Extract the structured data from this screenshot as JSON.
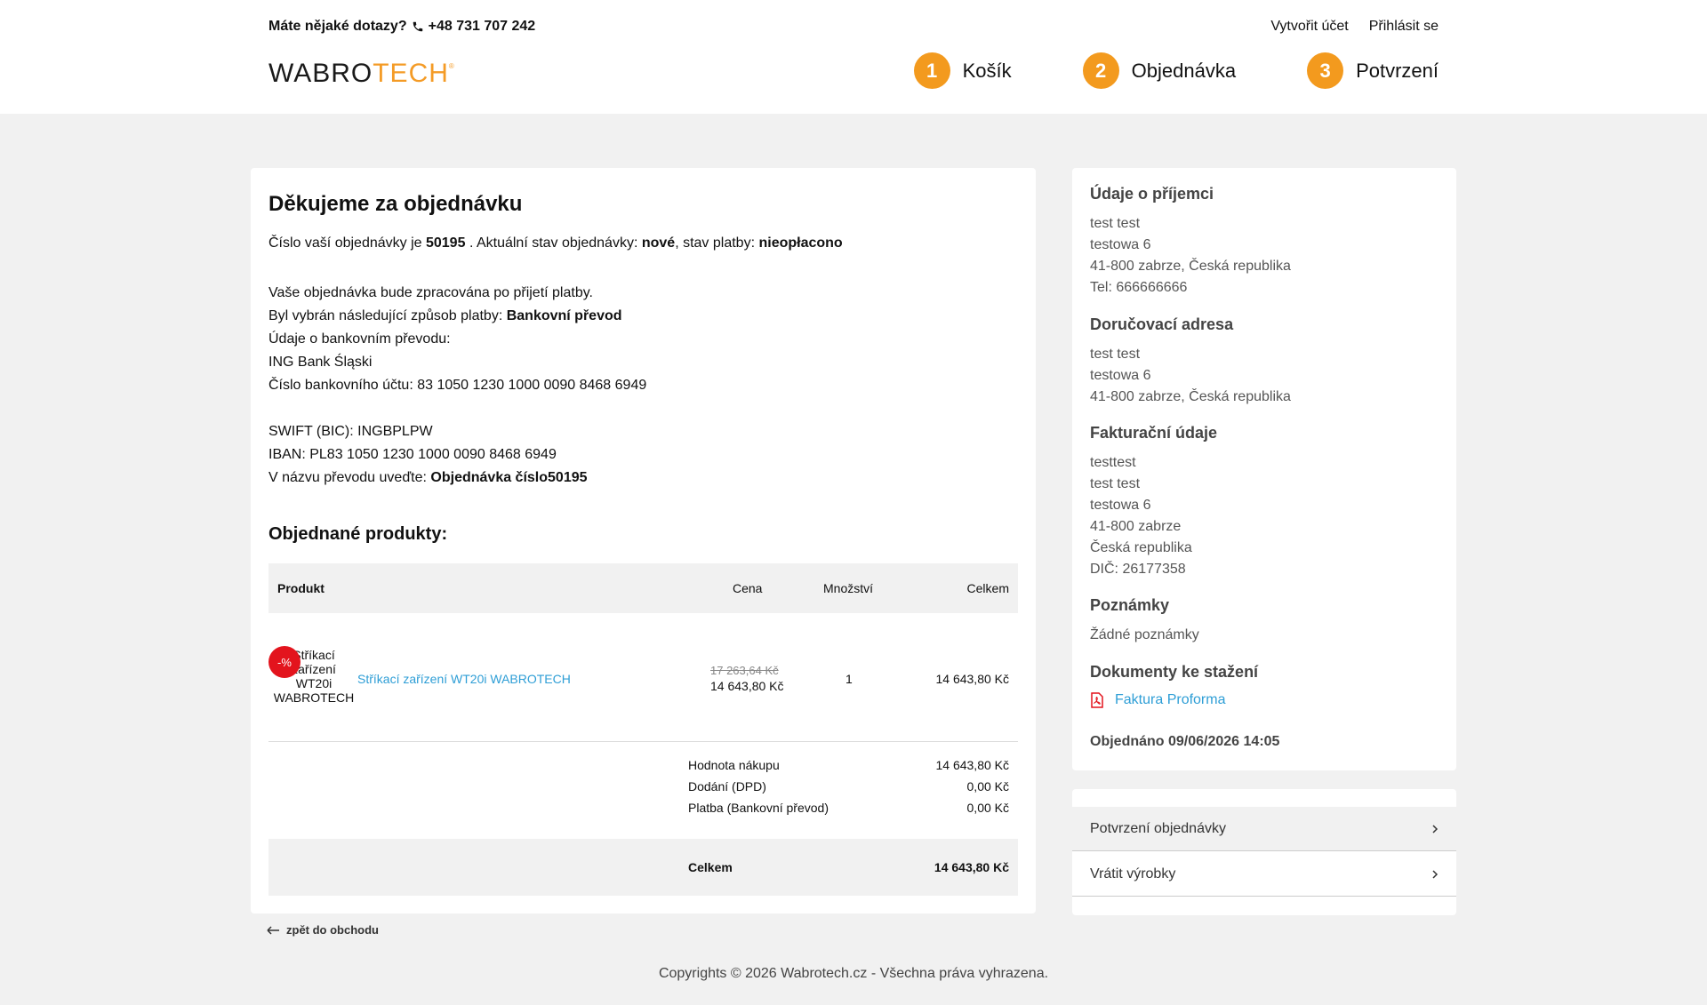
{
  "header": {
    "contact_question": "Máte nějaké dotazy?",
    "phone": "+48 731 707 242",
    "create_account": "Vytvořit účet",
    "login": "Přihlásit se",
    "logo_part1": "WABRO",
    "logo_part2": "TECH",
    "logo_reg": "®",
    "steps": [
      {
        "num": "1",
        "label": "Košík"
      },
      {
        "num": "2",
        "label": "Objednávka"
      },
      {
        "num": "3",
        "label": "Potvrzení"
      }
    ]
  },
  "order": {
    "title": "Děkujeme za objednávku",
    "number_prefix": "Číslo vaší objednávky je",
    "number": "50195",
    "status_prefix": ". Aktuální stav objednávky:",
    "status": "nové",
    "payment_status_prefix": ", stav platby:",
    "payment_status": "nieopłacono",
    "processing_note": "Vaše objednávka bude zpracována po přijetí platby.",
    "payment_method_prefix": "Byl vybrán následující způsob platby:",
    "payment_method": "Bankovní převod",
    "bank_info_label": "Údaje o bankovním převodu:",
    "bank_name": "ING Bank Śląski",
    "account_number": "Číslo bankovního účtu: 83 1050 1230 1000 0090 8468 6949",
    "swift": "SWIFT (BIC): INGBPLPW",
    "iban": "IBAN: PL83 1050 1230 1000 0090 8468 6949",
    "transfer_title_prefix": "V názvu převodu uveďte:",
    "transfer_title": "Objednávka číslo50195"
  },
  "products": {
    "title": "Objednané produkty:",
    "columns": {
      "product": "Produkt",
      "price": "Cena",
      "qty": "Množství",
      "total": "Celkem"
    },
    "items": [
      {
        "image_alt_line1": "Stříkací",
        "image_alt_line2": "zařízení",
        "image_alt_line3": "WT20i",
        "image_alt_line4": "WABROTECH",
        "badge": "-%",
        "name": "Stříkací zařízení WT20i WABROTECH",
        "old_price": "17 263,64 Kč",
        "price": "14 643,80 Kč",
        "qty": "1",
        "total": "14 643,80 Kč"
      }
    ]
  },
  "summary": {
    "rows": [
      {
        "label": "Hodnota nákupu",
        "value": "14 643,80 Kč"
      },
      {
        "label": "Dodání (DPD)",
        "value": "0,00 Kč"
      },
      {
        "label": "Platba (Bankovní převod)",
        "value": "0,00 Kč"
      }
    ],
    "total_label": "Celkem",
    "total_value": "14 643,80 Kč"
  },
  "back_link": "zpět do obchodu",
  "sidebar": {
    "recipient_title": "Údaje o příjemci",
    "recipient_lines": [
      "test test",
      "testowa 6",
      "41-800 zabrze, Česká republika",
      "Tel: 666666666"
    ],
    "delivery_title": "Doručovací adresa",
    "delivery_lines": [
      "test test",
      "testowa 6",
      "41-800 zabrze, Česká republika"
    ],
    "billing_title": "Fakturační údaje",
    "billing_lines": [
      "testtest",
      "test test",
      "testowa 6",
      "41-800 zabrze",
      "Česká republika",
      "DIČ: 26177358"
    ],
    "notes_title": "Poznámky",
    "notes_text": "Žádné poznámky",
    "docs_title": "Dokumenty ke stažení",
    "doc_link": "Faktura Proforma",
    "ordered_at": "Objednáno 09/06/2026 14:05"
  },
  "nav": [
    {
      "label": "Potvrzení objednávky",
      "active": true
    },
    {
      "label": "Vrátit výrobky",
      "active": false
    }
  ],
  "footer": "Copyrights © 2026 Wabrotech.cz - Všechna práva vyhrazena.",
  "colors": {
    "accent": "#f39a1e",
    "link": "#2e9ed6",
    "badge": "#e3141d"
  }
}
